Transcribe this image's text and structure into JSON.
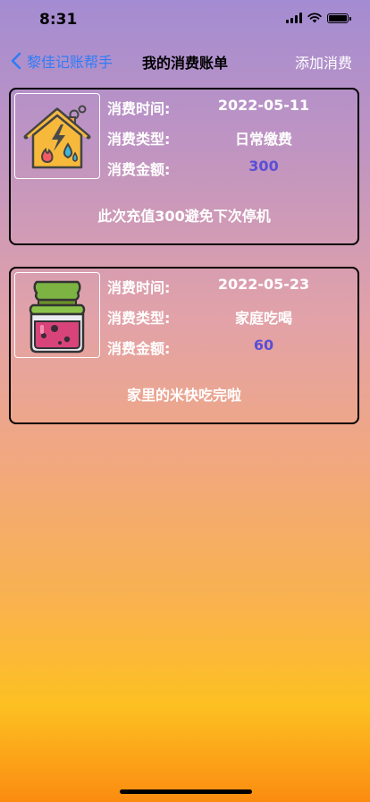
{
  "status_bar": {
    "time": "8:31"
  },
  "nav": {
    "back_label": "黎佳记账帮手",
    "title": "我的消费账单",
    "add_label": "添加消费"
  },
  "labels": {
    "time": "消费时间:",
    "type": "消费类型:",
    "amount": "消费金额:"
  },
  "records": [
    {
      "icon": "house-utilities-icon",
      "date": "2022-05-11",
      "type": "日常缴费",
      "amount": "300",
      "note": "此次充值300避免下次停机"
    },
    {
      "icon": "jam-jar-icon",
      "date": "2022-05-23",
      "type": "家庭吃喝",
      "amount": "60",
      "note": "家里的米快吃完啦"
    }
  ],
  "colors": {
    "back": "#2f7cf6",
    "amount": "#5a4fd6",
    "card_border": "#000000"
  }
}
